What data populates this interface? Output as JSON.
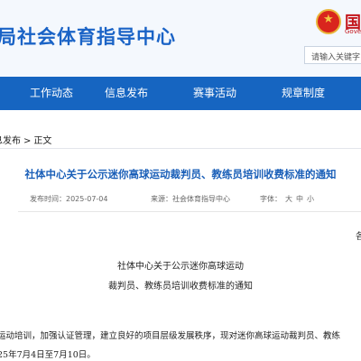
{
  "header": {
    "site_title": "局社会体育指导中心",
    "gov_name": "国",
    "gov_sub": "Gove",
    "search_placeholder": "请输入关键字"
  },
  "nav": {
    "items": [
      "工作动态",
      "信息发布",
      "赛事活动",
      "规章制度"
    ]
  },
  "breadcrumb": {
    "parent": "息发布",
    "separator": ">",
    "current": "正文"
  },
  "article": {
    "title": "社体中心关于公示迷你高球运动裁判员、教练员培训收费标准的通知",
    "date": "发布时间：2025-07-04",
    "source": "来源：社会体育指导中心",
    "font_label": "字体：",
    "font_large": "大",
    "font_medium": "中",
    "font_small": "小",
    "edge_char": "各",
    "heading_line1": "社体中心关于公示迷你高球运动",
    "heading_line2": "裁判员、教练员培训收费标准的通知",
    "para_line1": "运动培训，加强认证管理，建立良好的项目层级发展秩序，现对迷你高球运动裁判员、教练",
    "para_line2": "25年7月4日至7月10日。"
  },
  "colors": {
    "brand_blue": "#1665c1",
    "title_blue": "#1a63c6",
    "emblem_red": "#d9251d"
  }
}
